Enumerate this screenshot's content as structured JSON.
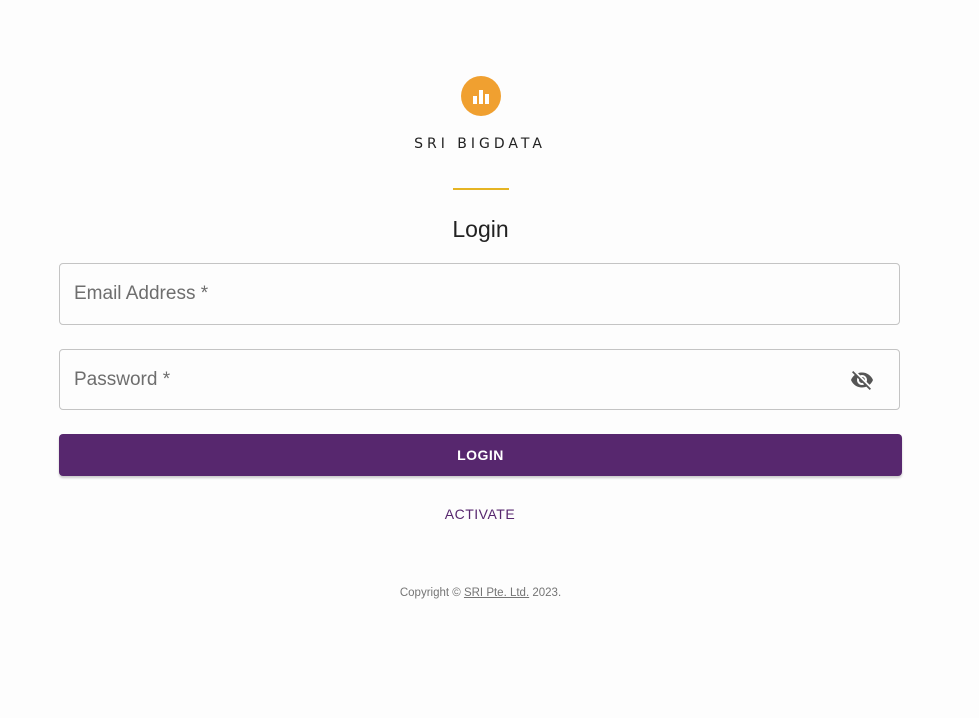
{
  "brand": {
    "icon": "bar-chart-icon",
    "icon_color": "#f0a030",
    "name": "SRI BIGDATA",
    "divider_color": "#e5b423"
  },
  "form": {
    "title": "Login",
    "email_label": "Email Address *",
    "password_label": "Password *",
    "password_toggle_icon": "eye-off-icon",
    "login_label": "LOGIN",
    "activate_label": "ACTIVATE",
    "primary_color": "#57276e"
  },
  "footer": {
    "copyright_prefix": "Copyright ©",
    "company_link": "SRI Pte. Ltd.",
    "year_suffix": "2023."
  }
}
